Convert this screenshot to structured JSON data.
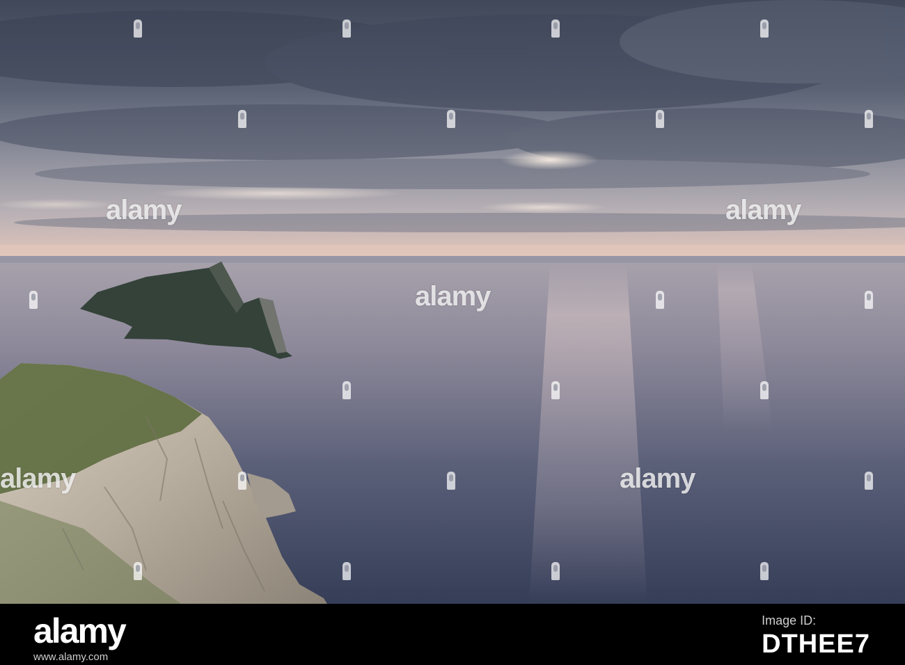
{
  "watermark": {
    "text": "alamy"
  },
  "footer": {
    "brand": "alamy",
    "image_id_label": "Image ID:",
    "image_id": "DTHEE7",
    "url": "www.alamy.com"
  },
  "colors": {
    "sky_dark": "#4a5265",
    "sky_light": "#b9b2b4",
    "horizon_glow": "#e6c8bf",
    "sea_light": "#a39aa3",
    "sea_dark": "#3c445d",
    "cliff_green": "#5f6f3f",
    "cliff_rock": "#c9c0b1",
    "island": "#35423a",
    "footer_bg": "#000000"
  }
}
